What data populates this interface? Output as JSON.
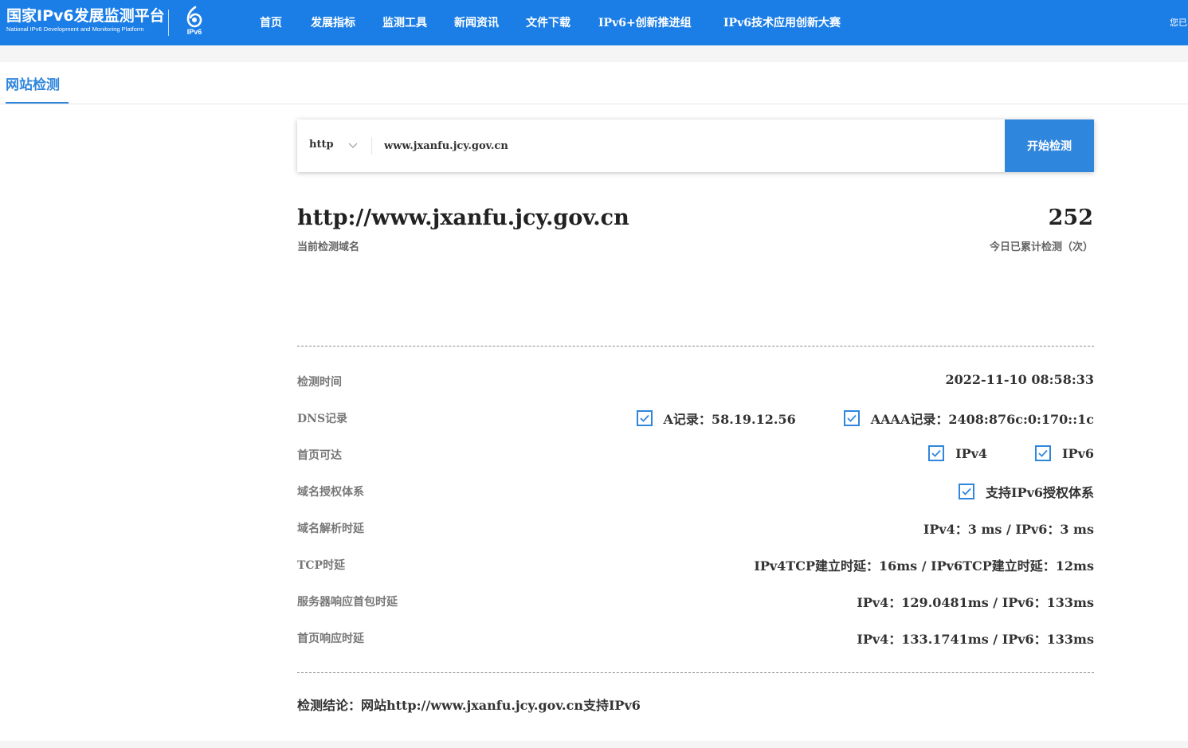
{
  "header": {
    "logo_title": "国家IPv6发展监测平台",
    "logo_subtitle": "National IPv6 Development and Monitoring Platform",
    "mark_text": "IPv6",
    "user_hint": "您已",
    "nav": [
      {
        "label": "首页"
      },
      {
        "label": "发展指标"
      },
      {
        "label": "监测工具"
      },
      {
        "label": "新闻资讯"
      },
      {
        "label": "文件下载"
      },
      {
        "label": "IPv6+创新推进组"
      },
      {
        "label": "IPv6技术应用创新大赛"
      }
    ]
  },
  "page": {
    "tab_label": "网站检测"
  },
  "search": {
    "protocol": "http",
    "url_value": "www.jxanfu.jcy.gov.cn",
    "start_label": "开始检测"
  },
  "summary": {
    "domain": "http://www.jxanfu.jcy.gov.cn",
    "domain_label": "当前检测域名",
    "count": "252",
    "count_label": "今日已累计检测（次）"
  },
  "rows": {
    "time": {
      "label": "检测时间",
      "value": "2022-11-10 08:58:33"
    },
    "dns": {
      "label": "DNS记录",
      "a_record": "A记录：58.19.12.56",
      "aaaa_record": "AAAA记录：2408:876c:0:170::1c"
    },
    "reach": {
      "label": "首页可达",
      "ipv4": "IPv4",
      "ipv6": "IPv6"
    },
    "auth": {
      "label": "域名授权体系",
      "value": "支持IPv6授权体系"
    },
    "resolve": {
      "label": "域名解析时延",
      "value": "IPv4：3 ms / IPv6：3 ms"
    },
    "tcp": {
      "label": "TCP时延",
      "value": "IPv4TCP建立时延：16ms / IPv6TCP建立时延：12ms"
    },
    "first_packet": {
      "label": "服务器响应首包时延",
      "value": "IPv4：129.0481ms / IPv6：133ms"
    },
    "page_response": {
      "label": "首页响应时延",
      "value": "IPv4：133.1741ms / IPv6：133ms"
    }
  },
  "conclusion": "检测结论：网站http://www.jxanfu.jcy.gov.cn支持IPv6",
  "colors": {
    "header_bg": "#1b7ee6",
    "accent": "#2f86dd",
    "page_bg": "#f5f5f5"
  },
  "icons": {
    "checkbox": "checked-box-icon",
    "dropdown": "chevron-down-icon",
    "logo": "ipv6-logo-icon"
  }
}
